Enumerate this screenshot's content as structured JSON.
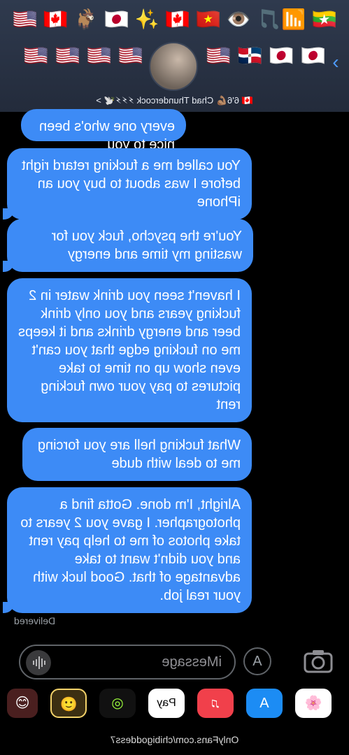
{
  "header": {
    "emoji_row_1": [
      "🇲🇲",
      "📶🎵",
      "👁️",
      "🇻🇳",
      "🇨🇦",
      "✨",
      "🇯🇵",
      "🐐",
      "🇨🇦",
      "🇺🇸"
    ],
    "emoji_row_2_left": [
      "🇯🇵",
      "🇯🇵",
      "🇩🇴",
      "🇺🇸"
    ],
    "emoji_row_2_right": [
      "🇺🇸",
      "🇺🇸",
      "🇺🇸",
      "🇺🇸"
    ],
    "contact_name": "🇨🇦 6'6💪🏽 Chad Thundercock ⚡⚡⚡🕊️ >",
    "chevron": "›"
  },
  "messages": [
    {
      "text": "every one who's been nice to you"
    },
    {
      "text": "You called me a fucking retard right before I was about to buy you an iPhone"
    },
    {
      "text": "You're the psycho, fuck you for wasting my time and energy"
    },
    {
      "text": "I haven't seen you drink water in 2 fucking years and you only drink beer and energy drinks and it keeps me on fucking edge that you can't even show up on time to take pictures to pay your own fucking rent"
    },
    {
      "text": "What fucking hell are you forcing me to deal with dude"
    },
    {
      "text": "Alright, I'm done. Gotta find a photographer. I gave you 2 years to take photos of me to help pay rent and you didn't want to take advantage of that. Good luck with your real job."
    }
  ],
  "status": "Delivered",
  "input": {
    "placeholder": "iMessage"
  },
  "apps": [
    {
      "name": "photos",
      "label": "🌸"
    },
    {
      "name": "app-store",
      "label": "A"
    },
    {
      "name": "music",
      "label": "♫"
    },
    {
      "name": "apple-pay",
      "label": "Pay"
    },
    {
      "name": "fitness",
      "label": "◎"
    },
    {
      "name": "memoji",
      "label": "🙂"
    },
    {
      "name": "stickers",
      "label": "😊"
    }
  ],
  "watermark": "OnlyFans.com/chibigoddess7",
  "colors": {
    "bubble": "#3d8bf6",
    "background": "#000000",
    "header": "#2b3446",
    "chevron": "#4e9bff"
  }
}
